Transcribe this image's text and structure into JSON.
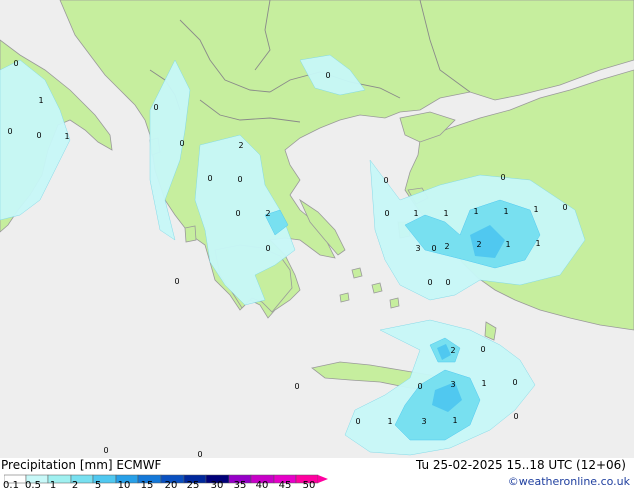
{
  "footer": {
    "title": "Precipitation [mm] ECMWF",
    "validity": "Tu 25-02-2025 15..18 UTC (12+06)",
    "credit": "©weatheronline.co.uk"
  },
  "legend": {
    "ticks": [
      "0.1",
      "0.5",
      "1",
      "2",
      "5",
      "10",
      "15",
      "20",
      "25",
      "30",
      "35",
      "40",
      "45",
      "50"
    ],
    "colors": [
      "#ffffff",
      "#c8f8f8",
      "#a0f0f0",
      "#78e0f0",
      "#50c8f0",
      "#28a0e8",
      "#1478d8",
      "#0a50c0",
      "#00289c",
      "#000078",
      "#9600c8",
      "#c800c8",
      "#e600c8",
      "#ff00a0"
    ]
  },
  "map": {
    "land_color": "#c6ee9e",
    "sea_color": "#eeeeee",
    "border_color": "#8a8a8a",
    "precip_labels": [
      {
        "text": "0"
      },
      {
        "text": "1"
      },
      {
        "text": "0"
      },
      {
        "text": "1"
      },
      {
        "text": "0"
      },
      {
        "text": "0"
      },
      {
        "text": "0"
      },
      {
        "text": "2"
      },
      {
        "text": "0"
      },
      {
        "text": "0"
      },
      {
        "text": "0"
      },
      {
        "text": "2"
      },
      {
        "text": "0"
      },
      {
        "text": "0"
      },
      {
        "text": "0"
      },
      {
        "text": "0"
      },
      {
        "text": "1"
      },
      {
        "text": "1"
      },
      {
        "text": "3"
      },
      {
        "text": "2"
      },
      {
        "text": "0"
      },
      {
        "text": "0"
      },
      {
        "text": "1"
      },
      {
        "text": "0"
      },
      {
        "text": "1"
      },
      {
        "text": "1"
      },
      {
        "text": "0"
      },
      {
        "text": "2"
      },
      {
        "text": "1"
      },
      {
        "text": "1"
      },
      {
        "text": "0"
      },
      {
        "text": "0"
      },
      {
        "text": "2"
      },
      {
        "text": "0"
      },
      {
        "text": "0"
      },
      {
        "text": "3"
      },
      {
        "text": "1"
      },
      {
        "text": "0"
      },
      {
        "text": "0"
      },
      {
        "text": "1"
      },
      {
        "text": "3"
      },
      {
        "text": "1"
      },
      {
        "text": "0"
      },
      {
        "text": "0"
      },
      {
        "text": "0"
      },
      {
        "text": "0"
      }
    ]
  }
}
